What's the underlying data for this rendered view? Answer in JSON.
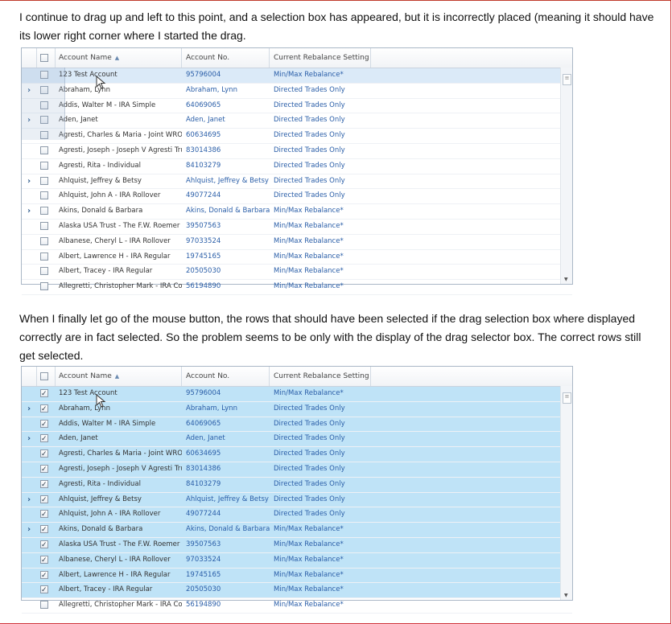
{
  "text": {
    "para1": "I continue to drag up and left to this point, and a selection box has appeared, but it is incorrectly placed (meaning it should have its lower right corner where I started the drag.",
    "para2": "When I finally let go of the mouse button, the rows that should have been selected if the drag selection box where displayed correctly are in fact selected. So the problem seems to be only with the display of the drag selector box. The correct rows still get selected."
  },
  "columns": {
    "name": "Account Name",
    "acct": "Account No.",
    "rebalance": "Current Rebalance Setting"
  },
  "icons": {
    "sort": "sort-ascending-icon",
    "expand": "expand-chevron-icon",
    "cursor": "mouse-pointer-icon"
  },
  "colors": {
    "selected_row": "#bfe3f7",
    "link": "#2a5ea8",
    "page_border": "#d0343b"
  },
  "rows": [
    {
      "name": "123 Test Account",
      "acct": "95796004",
      "reb": "Min/Max Rebalance*",
      "exp": false,
      "acct_link": false
    },
    {
      "name": "Abraham, Lynn",
      "acct": "Abraham, Lynn",
      "reb": "Directed Trades Only",
      "exp": true,
      "acct_link": true
    },
    {
      "name": "Addis, Walter M - IRA Simple",
      "acct": "64069065",
      "reb": "Directed Trades Only",
      "exp": false,
      "acct_link": false
    },
    {
      "name": "Aden, Janet",
      "acct": "Aden, Janet",
      "reb": "Directed Trades Only",
      "exp": true,
      "acct_link": true
    },
    {
      "name": "Agresti, Charles & Maria - Joint WROS",
      "acct": "60634695",
      "reb": "Directed Trades Only",
      "exp": false,
      "acct_link": false
    },
    {
      "name": "Agresti, Joseph - Joseph V Agresti Trust",
      "acct": "83014386",
      "reb": "Directed Trades Only",
      "exp": false,
      "acct_link": false
    },
    {
      "name": "Agresti, Rita - Individual",
      "acct": "84103279",
      "reb": "Directed Trades Only",
      "exp": false,
      "acct_link": false
    },
    {
      "name": "Ahlquist, Jeffrey & Betsy",
      "acct": "Ahlquist, Jeffrey & Betsy",
      "reb": "Directed Trades Only",
      "exp": true,
      "acct_link": true
    },
    {
      "name": "Ahlquist, John A - IRA Rollover",
      "acct": "49077244",
      "reb": "Directed Trades Only",
      "exp": false,
      "acct_link": false
    },
    {
      "name": "Akins, Donald & Barbara",
      "acct": "Akins, Donald & Barbara",
      "reb": "Min/Max Rebalance*",
      "exp": true,
      "acct_link": true
    },
    {
      "name": "Alaska USA Trust - The F.W. Roemer Trust",
      "acct": "39507563",
      "reb": "Min/Max Rebalance*",
      "exp": false,
      "acct_link": false
    },
    {
      "name": "Albanese, Cheryl L - IRA Rollover",
      "acct": "97033524",
      "reb": "Min/Max Rebalance*",
      "exp": false,
      "acct_link": false
    },
    {
      "name": "Albert, Lawrence H - IRA Regular",
      "acct": "19745165",
      "reb": "Min/Max Rebalance*",
      "exp": false,
      "acct_link": false
    },
    {
      "name": "Albert, Tracey - IRA Regular",
      "acct": "20505030",
      "reb": "Min/Max Rebalance*",
      "exp": false,
      "acct_link": false
    },
    {
      "name": "Allegretti, Christopher Mark - IRA Contribution",
      "acct": "56194890",
      "reb": "Min/Max Rebalance*",
      "exp": false,
      "acct_link": false
    }
  ],
  "grid2_selected": [
    true,
    true,
    true,
    true,
    true,
    true,
    true,
    true,
    true,
    true,
    true,
    true,
    true,
    true,
    false
  ]
}
